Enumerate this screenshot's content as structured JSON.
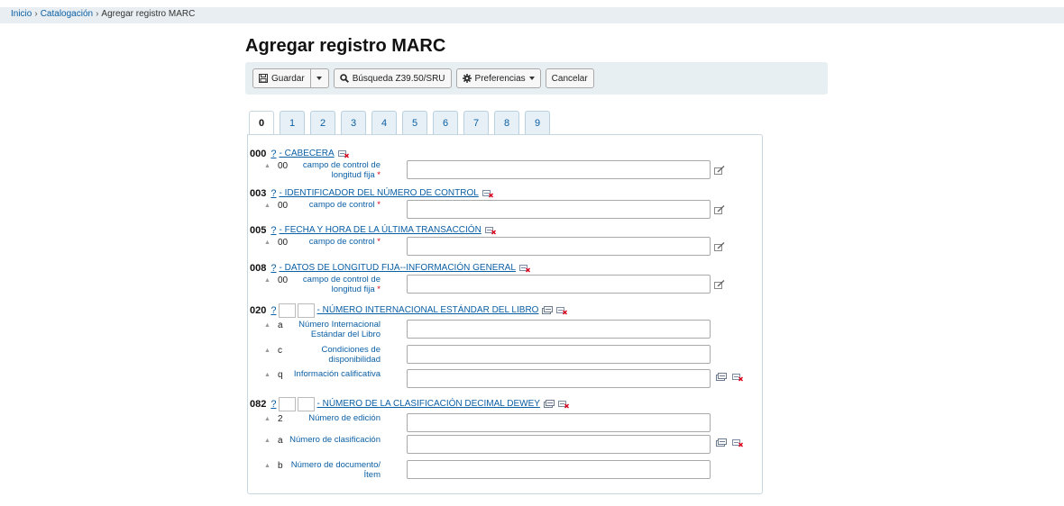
{
  "breadcrumb": {
    "home": "Inicio",
    "sep": "›",
    "catalog": "Catalogación",
    "current": "Agregar registro MARC"
  },
  "page_title": "Agregar registro MARC",
  "toolbar": {
    "save": "Guardar",
    "z3950": "Búsqueda Z39.50/SRU",
    "prefs": "Preferencias",
    "cancel": "Cancelar"
  },
  "tabs": [
    "0",
    "1",
    "2",
    "3",
    "4",
    "5",
    "6",
    "7",
    "8",
    "9"
  ],
  "active_tab": "0",
  "fields": [
    {
      "tag": "000",
      "q": "?",
      "desc": "- CABECERA",
      "subs": [
        {
          "code": "00",
          "label": "campo de control de longitud fija",
          "required": "*",
          "value": ""
        }
      ]
    },
    {
      "tag": "003",
      "q": "?",
      "desc": "- IDENTIFICADOR DEL NÚMERO DE CONTROL",
      "subs": [
        {
          "code": "00",
          "label": "campo de control",
          "required": "*",
          "value": ""
        }
      ]
    },
    {
      "tag": "005",
      "q": "?",
      "desc": "- FECHA Y HORA DE LA ÚLTIMA TRANSACCIÓN",
      "subs": [
        {
          "code": "00",
          "label": "campo de control",
          "required": "*",
          "value": ""
        }
      ]
    },
    {
      "tag": "008",
      "q": "?",
      "desc": "- DATOS DE LONGITUD FIJA--INFORMACIÓN GENERAL",
      "subs": [
        {
          "code": "00",
          "label": "campo de control de longitud fija",
          "required": "*",
          "value": ""
        }
      ]
    },
    {
      "tag": "020",
      "q": "?",
      "desc": "- NÚMERO INTERNACIONAL ESTÁNDAR DEL LIBRO",
      "subs": [
        {
          "code": "a",
          "label": "Número Internacional Estándar del Libro",
          "value": ""
        },
        {
          "code": "c",
          "label": "Condiciones de disponibilidad",
          "value": ""
        },
        {
          "code": "q",
          "label": "Información calificativa",
          "value": ""
        }
      ]
    },
    {
      "tag": "082",
      "q": "?",
      "desc": "- NÚMERO DE LA CLASIFICACIÓN DECIMAL DEWEY",
      "subs": [
        {
          "code": "2",
          "label": "Número de edición",
          "value": ""
        },
        {
          "code": "a",
          "label": "Número de clasificación",
          "value": ""
        },
        {
          "code": "b",
          "label": "Número de documento/Ítem",
          "value": ""
        }
      ]
    }
  ],
  "colors": {
    "link": "#0b5fa5",
    "toolbar_bg": "#e7eff2",
    "breadcrumb_bg": "#e8eef1",
    "required": "#d9001b"
  }
}
